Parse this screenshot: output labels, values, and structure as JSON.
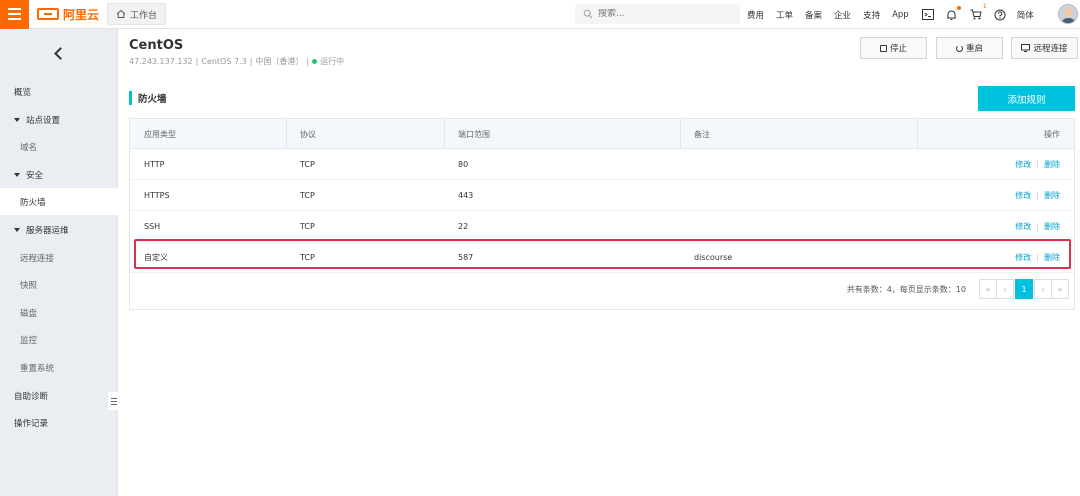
{
  "topbar": {
    "brand": "阿里云",
    "workbench_label": "工作台",
    "search_placeholder": "搜索...",
    "nav_items": [
      "费用",
      "工单",
      "备案",
      "企业",
      "支持",
      "App"
    ],
    "cart_badge": "1",
    "language": "简体",
    "accent_color": "#ff6a00"
  },
  "sidebar": {
    "items": [
      {
        "label": "概览",
        "kind": "top"
      },
      {
        "label": "站点设置",
        "kind": "group"
      },
      {
        "label": "域名",
        "kind": "sub"
      },
      {
        "label": "安全",
        "kind": "group"
      },
      {
        "label": "防火墙",
        "kind": "sub",
        "active": true
      },
      {
        "label": "服务器运维",
        "kind": "group"
      },
      {
        "label": "远程连接",
        "kind": "sub"
      },
      {
        "label": "快照",
        "kind": "sub"
      },
      {
        "label": "磁盘",
        "kind": "sub"
      },
      {
        "label": "监控",
        "kind": "sub"
      },
      {
        "label": "重置系统",
        "kind": "sub"
      },
      {
        "label": "自助诊断",
        "kind": "top"
      },
      {
        "label": "操作记录",
        "kind": "top"
      }
    ]
  },
  "header": {
    "title": "CentOS",
    "ip": "47.243.137.132",
    "os": "CentOS 7.3",
    "region": "中国（香港）",
    "status": "运行中",
    "status_color": "#1ec56b",
    "buttons": {
      "stop": "停止",
      "restart": "重启",
      "remote": "远程连接"
    }
  },
  "firewall": {
    "section_title": "防火墙",
    "add_rule_label": "添加规则",
    "primary_color": "#00c1de",
    "columns": [
      "应用类型",
      "协议",
      "端口范围",
      "备注",
      "操作"
    ],
    "rows": [
      {
        "app": "HTTP",
        "protocol": "TCP",
        "port": "80",
        "note": "",
        "edit": "修改",
        "delete": "删除"
      },
      {
        "app": "HTTPS",
        "protocol": "TCP",
        "port": "443",
        "note": "",
        "edit": "修改",
        "delete": "删除"
      },
      {
        "app": "SSH",
        "protocol": "TCP",
        "port": "22",
        "note": "",
        "edit": "修改",
        "delete": "删除"
      },
      {
        "app": "自定义",
        "protocol": "TCP",
        "port": "587",
        "note": "discourse",
        "edit": "修改",
        "delete": "删除"
      }
    ],
    "highlight_color": "#d9304f",
    "pagination": {
      "summary": "共有条数：4，每页显示条数：10",
      "first": "«",
      "prev": "‹",
      "current": "1",
      "next": "›",
      "last": "»"
    }
  }
}
